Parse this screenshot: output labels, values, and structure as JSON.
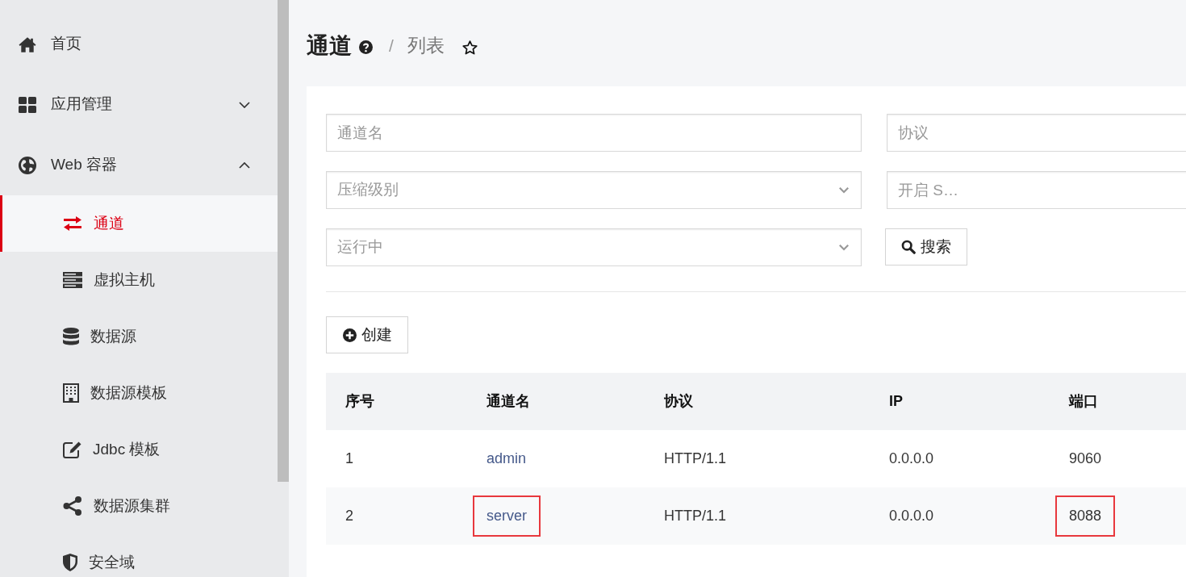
{
  "sidebar": {
    "items": [
      {
        "label": "首页",
        "kind": "link",
        "selected": false
      },
      {
        "label": "应用管理",
        "kind": "group",
        "selected": false,
        "expanded": false
      },
      {
        "label": "Web 容器",
        "kind": "group",
        "selected": false,
        "expanded": true,
        "children": [
          {
            "label": "通道",
            "selected": true
          },
          {
            "label": "虚拟主机",
            "selected": false
          },
          {
            "label": "数据源",
            "selected": false
          },
          {
            "label": "数据源模板",
            "selected": false
          },
          {
            "label": "Jdbc 模板",
            "selected": false
          },
          {
            "label": "数据源集群",
            "selected": false
          },
          {
            "label": "安全域",
            "selected": false
          }
        ]
      }
    ]
  },
  "header": {
    "title": "通道",
    "separator": "/",
    "subtitle": "列表"
  },
  "filters": [
    {
      "kind": "input",
      "placeholder": "通道名"
    },
    {
      "kind": "input",
      "placeholder": "协议"
    },
    {
      "kind": "select",
      "placeholder": "压缩级别"
    },
    {
      "kind": "input",
      "placeholder": "开启 S…"
    },
    {
      "kind": "select",
      "placeholder": "运行中"
    }
  ],
  "search_button": {
    "label": "搜索"
  },
  "create_button": {
    "label": "创建"
  },
  "table": {
    "columns": [
      {
        "label": "序号",
        "kind": "text"
      },
      {
        "label": "通道名",
        "kind": "link"
      },
      {
        "label": "协议",
        "kind": "text"
      },
      {
        "label": "IP",
        "kind": "text"
      },
      {
        "label": "端口",
        "kind": "text"
      }
    ],
    "rows": [
      {
        "cells": [
          {
            "text": "1",
            "highlighted": false
          },
          {
            "text": "admin",
            "highlighted": false
          },
          {
            "text": "HTTP/1.1",
            "highlighted": false
          },
          {
            "text": "0.0.0.0",
            "highlighted": false
          },
          {
            "text": "9060",
            "highlighted": false
          }
        ]
      },
      {
        "cells": [
          {
            "text": "2",
            "highlighted": false
          },
          {
            "text": "server",
            "highlighted": true
          },
          {
            "text": "HTTP/1.1",
            "highlighted": false
          },
          {
            "text": "0.0.0.0",
            "highlighted": false
          },
          {
            "text": "8088",
            "highlighted": true
          }
        ]
      }
    ]
  }
}
